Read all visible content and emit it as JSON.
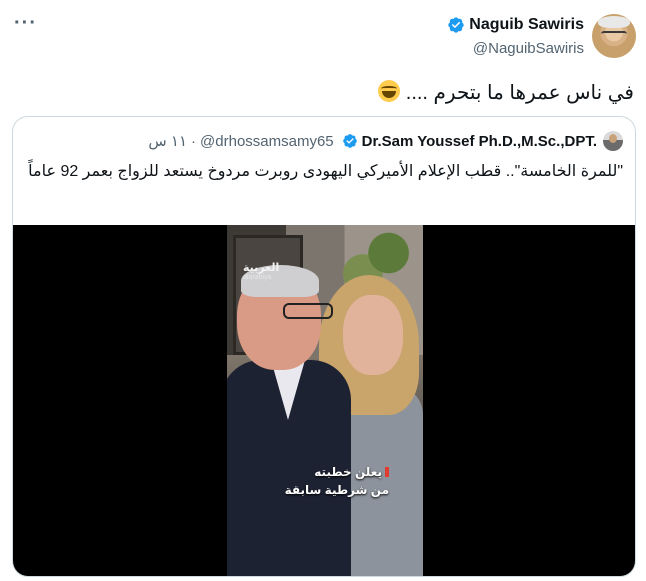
{
  "tweet": {
    "author_name": "Naguib Sawiris",
    "author_handle": "@NaguibSawiris",
    "text": "في ناس عمرها ما بتحرم ....",
    "more_label": "···"
  },
  "quoted_tweet": {
    "author_name": "Dr.Sam Youssef Ph.D.,M.Sc.,DPT.",
    "author_handle": "@drhossamsamy65",
    "separator": "·",
    "time": "١١ س",
    "text": "\"للمرة الخامسة\".. قطب الإعلام الأميركي اليهودى روبرت مردوخ يستعد للزواج بعمر 92 عاماً"
  },
  "video": {
    "logo_text": "العربية",
    "logo_sub": "alarabiya",
    "caption_line1": "يعلن خطبته",
    "caption_line2": "من شرطية سابقة"
  },
  "colors": {
    "verified": "#1d9bf0",
    "secondary_text": "#536471",
    "border": "#cfd9de"
  },
  "icons": {
    "verified": "verified-badge-icon",
    "emoji": "face-with-tears-of-joy-icon",
    "more": "more-dots-icon"
  }
}
